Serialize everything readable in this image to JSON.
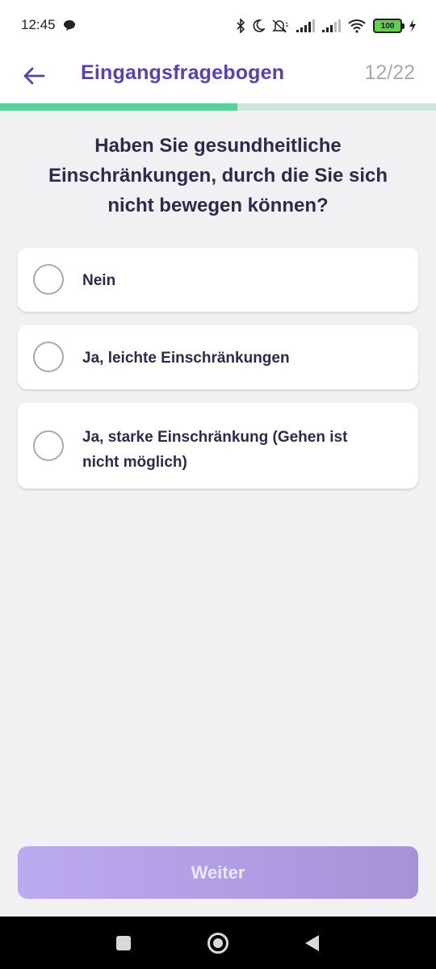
{
  "status_bar": {
    "time": "12:45",
    "icons": [
      "chat-bubble-icon",
      "bluetooth-icon",
      "moon-icon",
      "mute-icon",
      "signal-icon",
      "signal-icon",
      "wifi-icon",
      "battery-icon",
      "charging-icon"
    ],
    "battery_level": "100"
  },
  "header": {
    "title": "Eingangsfragebogen",
    "progress_text": "12/22",
    "back_icon": "arrow-left-icon",
    "progress_fraction": 0.545
  },
  "question": {
    "text": "Haben Sie gesundheitliche Einschränkungen, durch die Sie sich nicht bewegen können?"
  },
  "options": [
    {
      "label": "Nein",
      "selected": false
    },
    {
      "label": "Ja, leichte Einschränkungen",
      "selected": false
    },
    {
      "label": "Ja, starke Einschränkung (Gehen ist nicht möglich)",
      "selected": false
    }
  ],
  "continue_button": {
    "label": "Weiter",
    "enabled": false
  },
  "nav_bar": {
    "icons": [
      "recents-square-icon",
      "home-circle-icon",
      "back-triangle-icon"
    ]
  },
  "colors": {
    "accent": "#5b3fb3",
    "progress": "#56d39c",
    "progress_track": "#cce6dc",
    "button_start": "#bcaaf0",
    "button_end": "#a792d8",
    "background": "#f1f1f4"
  }
}
